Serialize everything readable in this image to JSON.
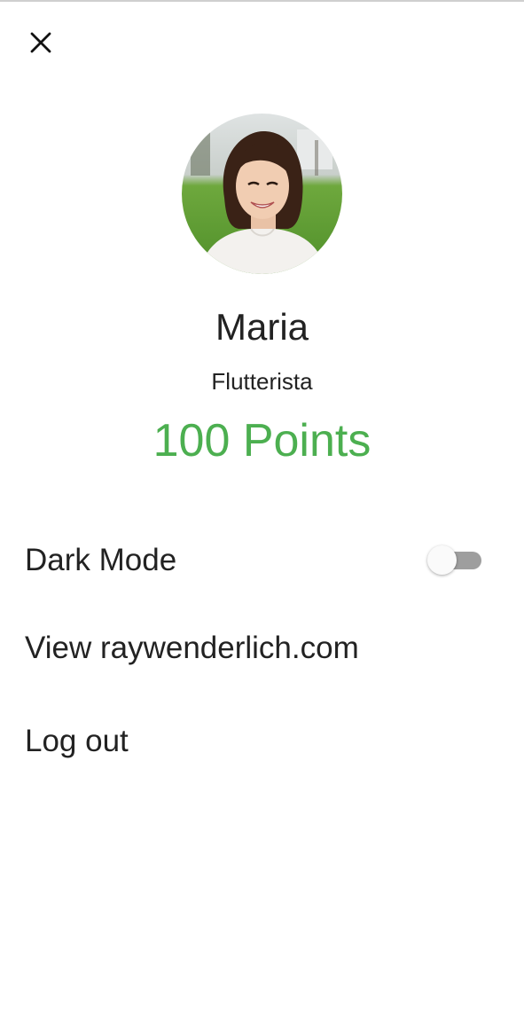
{
  "header": {
    "close_icon": "close-icon"
  },
  "profile": {
    "name": "Maria",
    "title": "Flutterista",
    "points": "100 Points",
    "points_color": "#4caf50"
  },
  "settings": {
    "dark_mode_label": "Dark Mode",
    "dark_mode_enabled": false,
    "view_site_label": "View raywenderlich.com",
    "logout_label": "Log out"
  }
}
